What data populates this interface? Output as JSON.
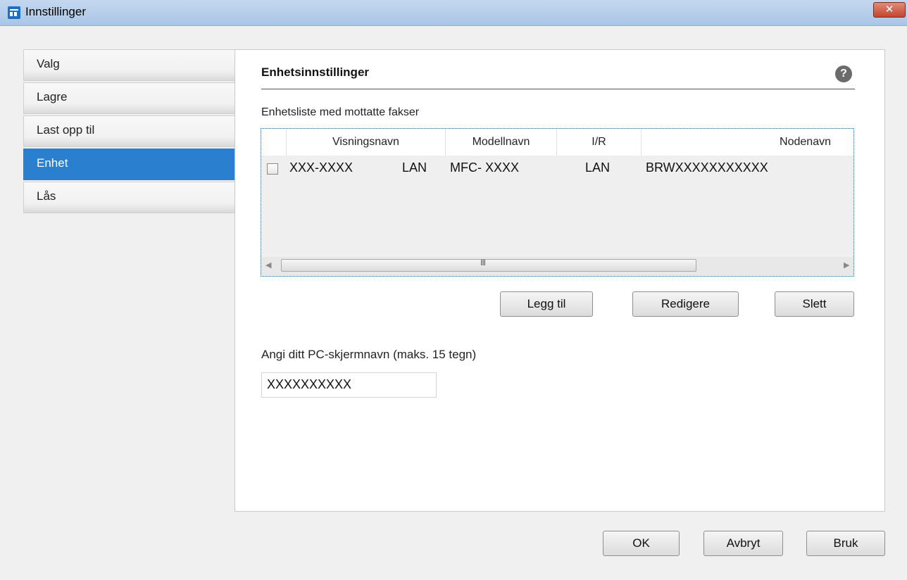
{
  "window": {
    "title": "Innstillinger",
    "close_glyph": "✕"
  },
  "sidebar": {
    "items": [
      {
        "label": "Valg"
      },
      {
        "label": "Lagre"
      },
      {
        "label": "Last opp til"
      },
      {
        "label": "Enhet",
        "selected": true
      },
      {
        "label": "Lås"
      }
    ]
  },
  "panel": {
    "title": "Enhetsinnstillinger",
    "help_glyph": "?",
    "list_label": "Enhetsliste med mottatte fakser",
    "columns": [
      "Visningsnavn",
      "Modellnavn",
      "I/R",
      "Nodenavn"
    ],
    "rows": [
      {
        "checked": false,
        "display_name": "XXX-XXXX",
        "display_conn": "LAN",
        "model": "MFC- XXXX",
        "io": "LAN",
        "node": "BRWXXXXXXXXXXX"
      }
    ],
    "scroll_grip": "III",
    "buttons": {
      "add": "Legg til",
      "edit": "Redigere",
      "delete": "Slett"
    },
    "pc_name_label": "Angi ditt PC-skjermnavn (maks. 15 tegn)",
    "pc_name_value": "XXXXXXXXXX"
  },
  "footer": {
    "ok": "OK",
    "cancel": "Avbryt",
    "apply": "Bruk"
  },
  "colors": {
    "accent": "#2b7fcf",
    "titlebar": "#b8cfea",
    "close": "#c4452f"
  },
  "icons": [
    "app-icon",
    "close-icon",
    "help-icon",
    "scroll-left-icon",
    "scroll-right-icon"
  ]
}
